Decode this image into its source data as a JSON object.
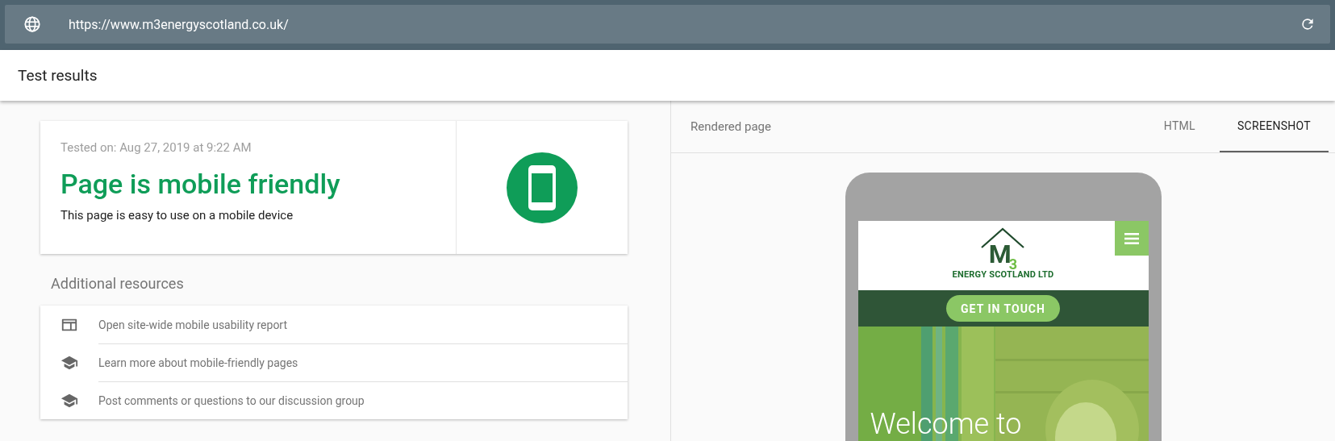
{
  "address_bar": {
    "url": "https://www.m3energyscotland.co.uk/"
  },
  "header": {
    "title": "Test results"
  },
  "result": {
    "tested_on": "Tested on: Aug 27, 2019 at 9:22 AM",
    "verdict": "Page is mobile friendly",
    "description": "This page is easy to use on a mobile device"
  },
  "resources": {
    "title": "Additional resources",
    "items": [
      {
        "kind": "report",
        "label": "Open site-wide mobile usability report"
      },
      {
        "kind": "learn",
        "label": "Learn more about mobile-friendly pages"
      },
      {
        "kind": "learn",
        "label": "Post comments or questions to our discussion group"
      }
    ]
  },
  "preview": {
    "title": "Rendered page",
    "tabs": [
      {
        "label": "HTML",
        "selected": false
      },
      {
        "label": "SCREENSHOT",
        "selected": true
      }
    ],
    "site": {
      "logo_letter": "M",
      "logo_digit": "3",
      "company": "ENERGY SCOTLAND LTD",
      "button": "GET IN TOUCH",
      "headline": "Welcome to"
    }
  }
}
